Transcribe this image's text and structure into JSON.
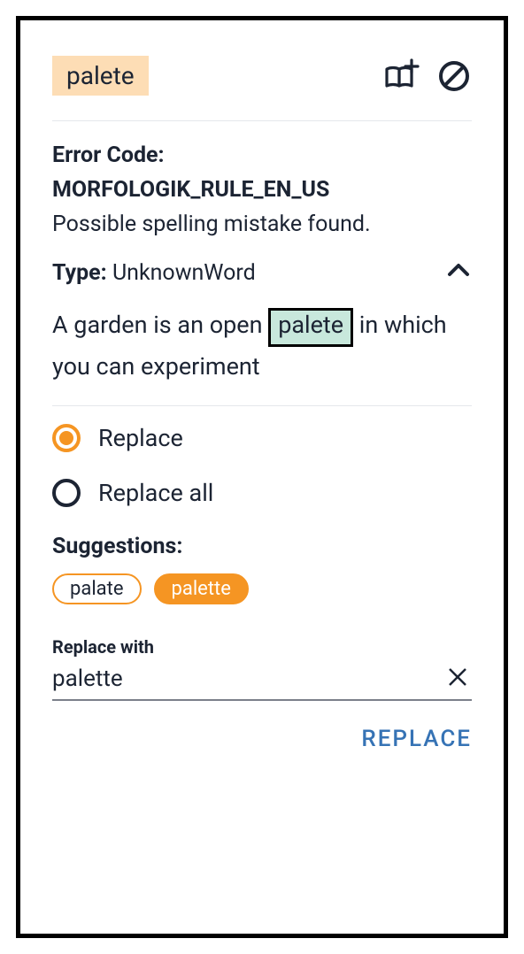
{
  "header": {
    "word": "palete"
  },
  "error": {
    "label": "Error Code:",
    "code": "MORFOLOGIK_RULE_EN_US",
    "description": "Possible spelling mistake found."
  },
  "type": {
    "label": "Type:",
    "value": "UnknownWord"
  },
  "context": {
    "before": "A garden is an open ",
    "highlight": "palete",
    "after": " in which you can experiment"
  },
  "options": {
    "replace": "Replace",
    "replace_all": "Replace all"
  },
  "suggestions": {
    "label": "Suggestions:",
    "items": [
      "palate",
      "palette"
    ]
  },
  "replace_with": {
    "label": "Replace with",
    "value": "palette"
  },
  "actions": {
    "replace": "REPLACE"
  }
}
